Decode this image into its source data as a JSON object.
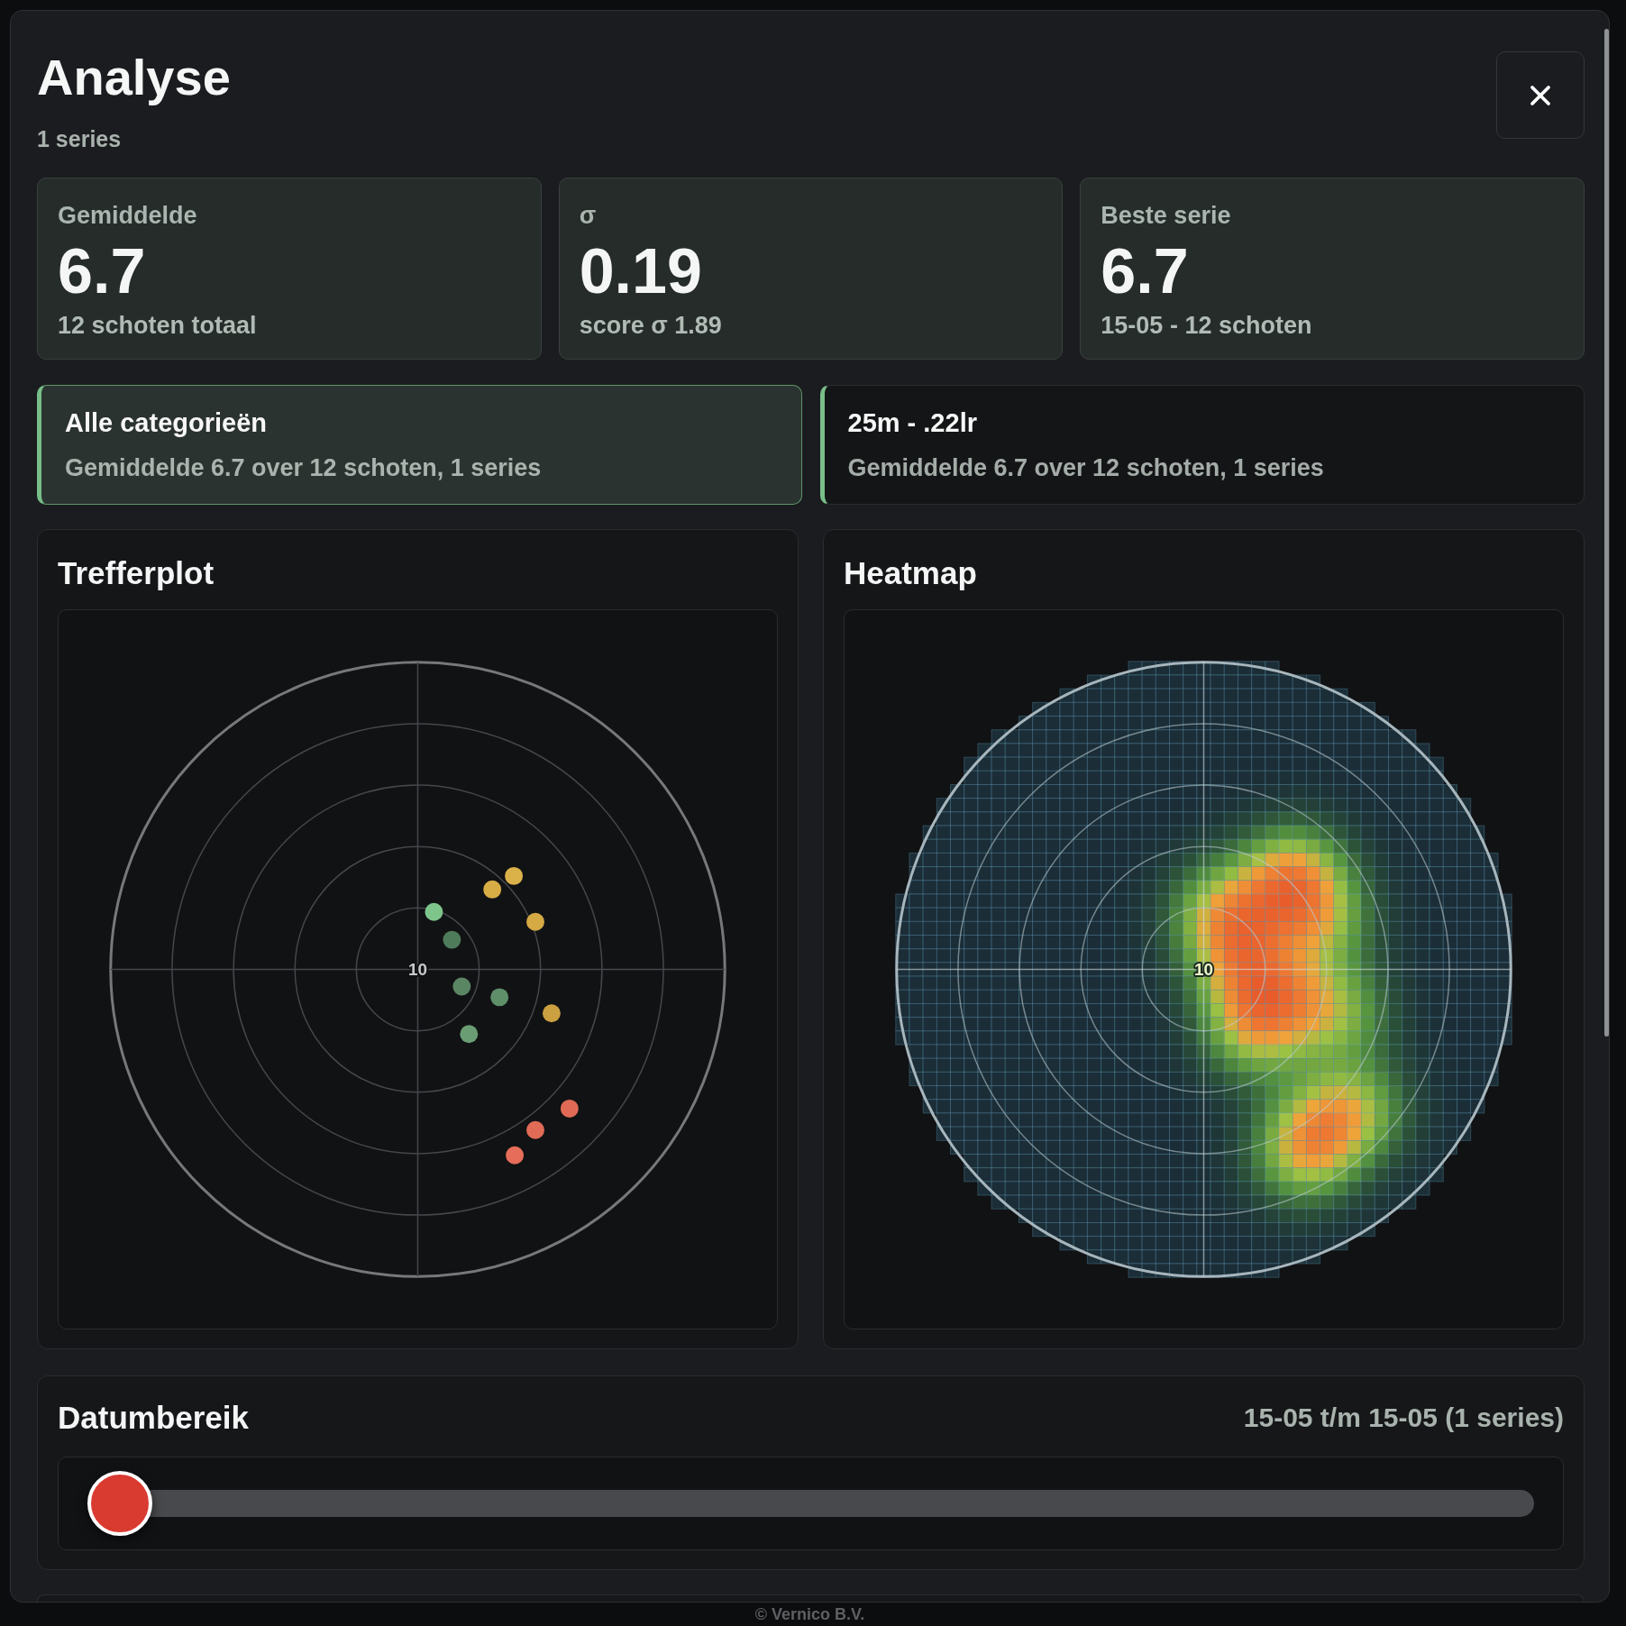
{
  "dialog": {
    "title": "Analyse",
    "subtitle": "1 series"
  },
  "stats": [
    {
      "label": "Gemiddelde",
      "value": "6.7",
      "note": "12 schoten totaal"
    },
    {
      "label": "σ",
      "value": "0.19",
      "note": "score σ 1.89"
    },
    {
      "label": "Beste serie",
      "value": "6.7",
      "note": "15-05 - 12 schoten"
    }
  ],
  "categories": [
    {
      "title": "Alle categorieën",
      "summary": "Gemiddelde 6.7 over 12 schoten, 1 series",
      "selected": true
    },
    {
      "title": "25m - .22lr",
      "summary": "Gemiddelde 6.7 over 12 schoten, 1 series",
      "selected": false
    }
  ],
  "plots": [
    {
      "kind": "hits",
      "title": "Trefferplot",
      "center_label": "10"
    },
    {
      "kind": "heatmap",
      "title": "Heatmap",
      "center_label": "10"
    }
  ],
  "date_range": {
    "title": "Datumbereik",
    "summary": "15-05 t/m 15-05 (1 series)",
    "level": 0
  },
  "footer": "© Vernico B.V."
}
